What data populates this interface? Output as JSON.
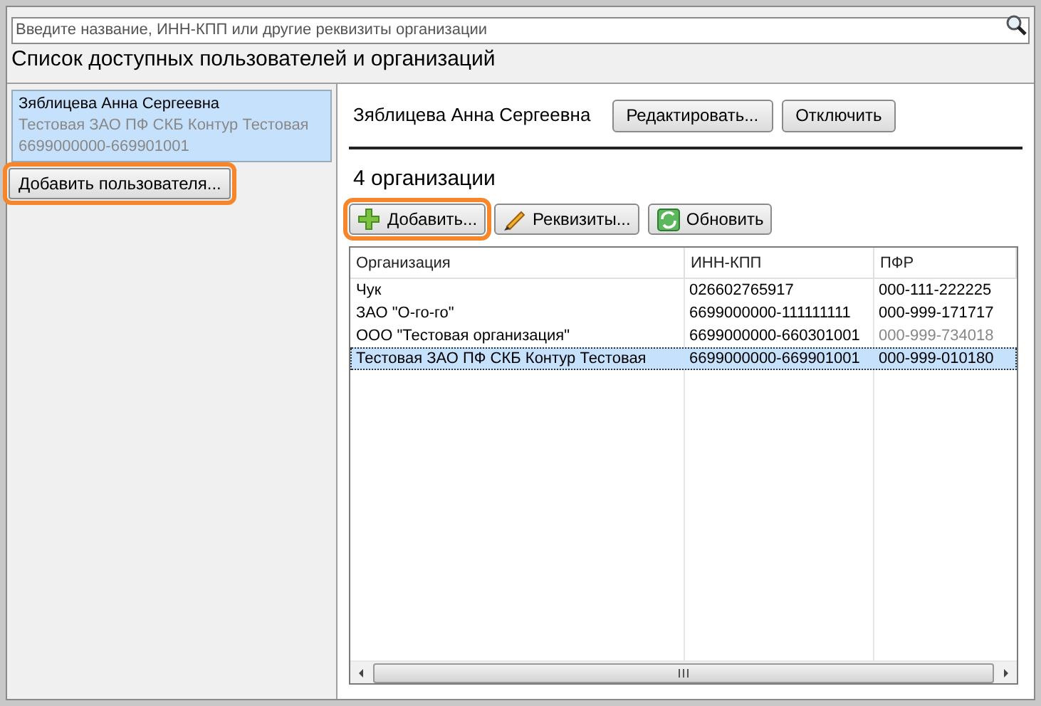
{
  "search": {
    "placeholder": "Введите название, ИНН-КПП или другие реквизиты организации"
  },
  "title": "Список доступных пользователей и организаций",
  "users": [
    {
      "name": "Зяблицева Анна Сергеевна",
      "organization": "Тестовая ЗАО ПФ СКБ Контур Тестовая",
      "inn_kpp": "6699000000-669901001",
      "selected": true
    }
  ],
  "add_user_button": {
    "label": "Добавить пользователя...",
    "highlighted": true
  },
  "user_header": {
    "name": "Зяблицева Анна Сергеевна",
    "buttons": [
      "Редактировать...",
      "Отключить"
    ]
  },
  "org_count": "4 организации",
  "toolbar": [
    {
      "kind": "add",
      "label": "Добавить...",
      "highlighted": true
    },
    {
      "kind": "edit",
      "label": "Реквизиты...",
      "highlighted": false
    },
    {
      "kind": "refresh",
      "label": "Обновить",
      "highlighted": false
    }
  ],
  "table": {
    "columns": [
      "Организация",
      "ИНН-КПП",
      "ПФР"
    ],
    "rows": [
      {
        "cells": [
          "Чук",
          "026602765917",
          "000-111-222225"
        ],
        "selected": false,
        "pfr_muted": false
      },
      {
        "cells": [
          "ЗАО \"О-го-го\"",
          "6699000000-111111111",
          "000-999-171717"
        ],
        "selected": false,
        "pfr_muted": false
      },
      {
        "cells": [
          "ООО \"Тестовая организация\"",
          "6699000000-660301001",
          "000-999-734018"
        ],
        "selected": false,
        "pfr_muted": true
      },
      {
        "cells": [
          "Тестовая ЗАО ПФ СКБ Контур Тестовая",
          "6699000000-669901001",
          "000-999-010180"
        ],
        "selected": true,
        "pfr_muted": false
      }
    ]
  }
}
